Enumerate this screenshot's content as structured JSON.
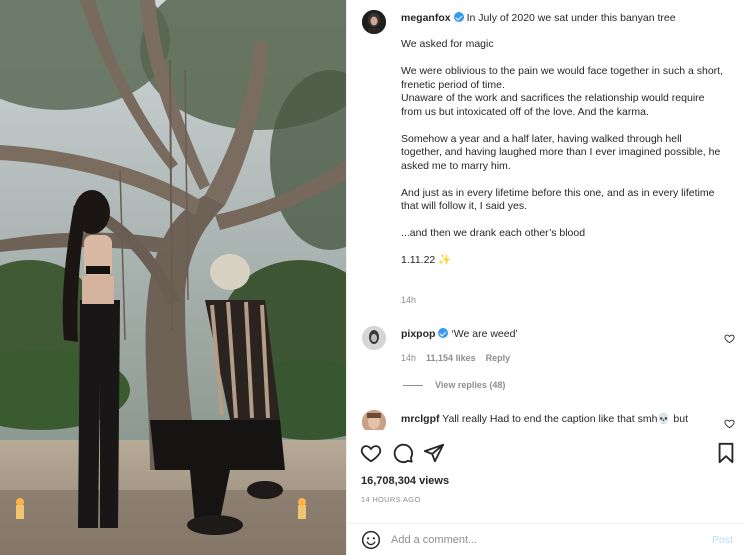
{
  "post": {
    "author": "meganfox",
    "caption_first_line": "In July of 2020 we sat under this banyan tree",
    "caption_paragraphs": [
      "We asked for magic",
      "We were oblivious to the pain we would face together in such a short, frenetic period of time.\nUnaware of the work and sacrifices the relationship would require from us but intoxicated off of the love. And the karma.",
      "Somehow a year and a half later, having walked through hell together, and having laughed more than I ever imagined possible, he asked me to marry him.",
      "And just as in every lifetime before this one, and as in every lifetime that will follow it, I said yes.",
      "...and then we drank each other’s blood",
      "1.11.22 ✨"
    ],
    "caption_time": "14h",
    "views": "16,708,304 views",
    "time_ago": "14 HOURS AGO"
  },
  "comments": [
    {
      "user": "pixpop",
      "text": "‘We are weed’",
      "time": "14h",
      "likes": "11,154 likes",
      "reply_label": "Reply",
      "view_replies": "View replies (48)"
    },
    {
      "user": "mrclgpf",
      "text": "Yall really Had to end the caption like that smh💀 but"
    }
  ],
  "composer": {
    "placeholder": "Add a comment...",
    "post_label": "Post"
  },
  "icons": {
    "verified": "verified-badge-icon",
    "like": "heart-icon",
    "comment": "comment-icon",
    "share": "paper-plane-icon",
    "save": "bookmark-icon",
    "emoji": "smiley-icon"
  },
  "colors": {
    "verified_blue": "#3897f0",
    "post_disabled": "#b2dffc",
    "muted_text": "#8e8e8e"
  }
}
